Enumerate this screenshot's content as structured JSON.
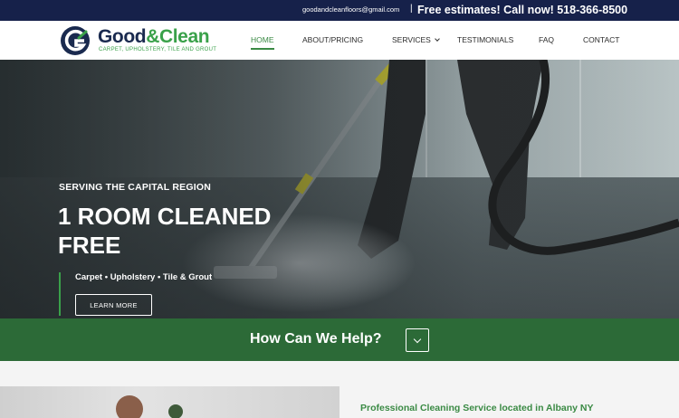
{
  "topbar": {
    "email": "goodandcleanfloors@gmail.com",
    "separator": "|",
    "cta": "Free estimates! Call now! 518-366-8500"
  },
  "brand": {
    "title_part1": "Good",
    "title_amp": "&",
    "title_part2": "Clean",
    "tagline": "CARPET, UPHOLSTERY, TILE AND GROUT",
    "primary_color": "#1a2a4f",
    "accent_color": "#3aa14a"
  },
  "nav": {
    "items": [
      {
        "label": "HOME",
        "active": true
      },
      {
        "label": "ABOUT/PRICING",
        "active": false
      },
      {
        "label": "SERVICES",
        "active": false,
        "has_dropdown": true
      },
      {
        "label": "TESTIMONIALS",
        "active": false
      },
      {
        "label": "FAQ",
        "active": false
      },
      {
        "label": "CONTACT",
        "active": false
      }
    ]
  },
  "hero": {
    "kicker": "SERVING THE CAPITAL REGION",
    "title": "1 ROOM CLEANED FREE",
    "services": "Carpet • Upholstery • Tile & Grout",
    "button_label": "LEARN MORE"
  },
  "help": {
    "text": "How Can We Help?",
    "band_color": "#2c6a37",
    "icon": "chevron-down-icon"
  },
  "intro": {
    "heading": "Professional Cleaning Service located in Albany NY"
  }
}
